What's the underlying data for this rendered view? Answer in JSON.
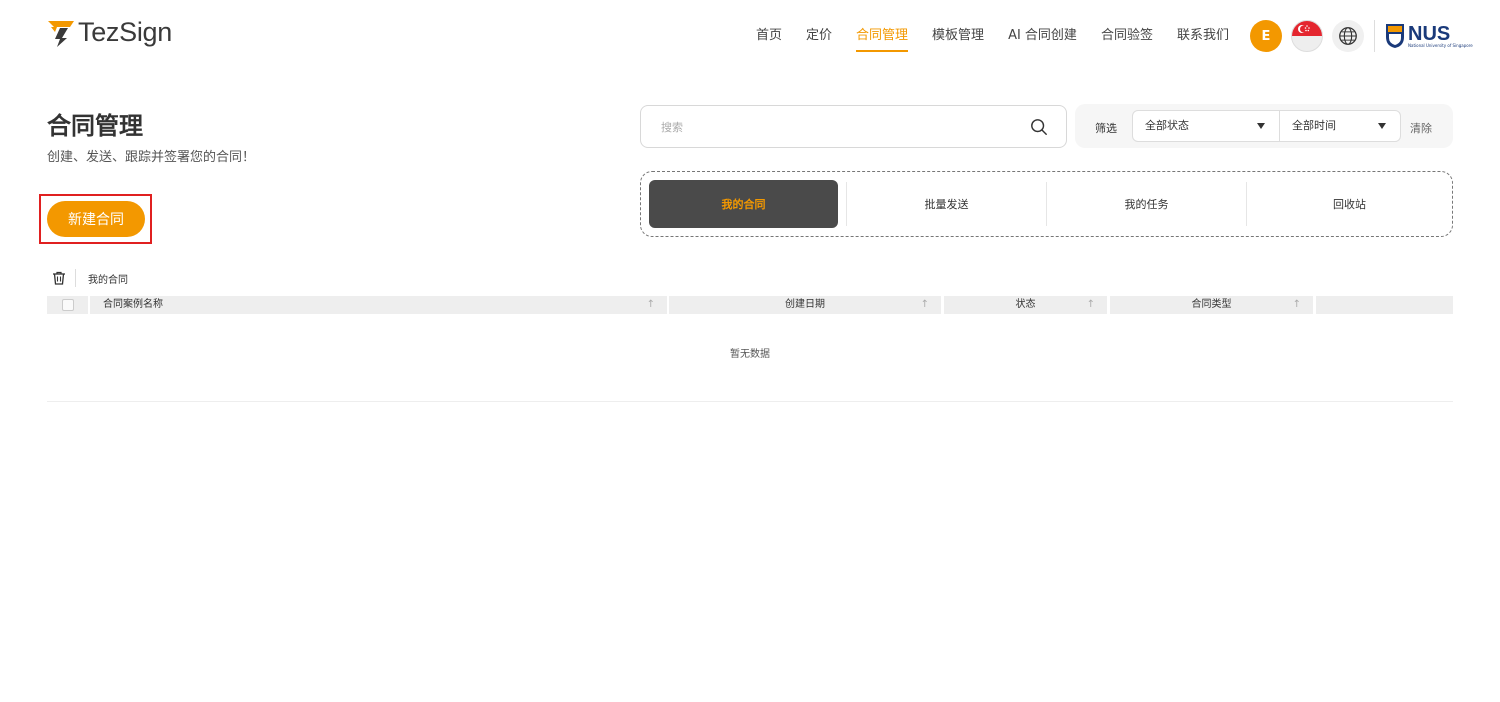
{
  "brand": {
    "name": "TezSign",
    "accent": "#f39800"
  },
  "nav": {
    "items": [
      {
        "label": "首页"
      },
      {
        "label": "定价"
      },
      {
        "label": "合同管理",
        "active": true
      },
      {
        "label": "模板管理"
      },
      {
        "label": "AI 合同创建"
      },
      {
        "label": "合同验签"
      },
      {
        "label": "联系我们"
      }
    ]
  },
  "header": {
    "avatar_initial": "E",
    "flag_icon": "singapore-flag-icon",
    "globe_icon": "globe-icon",
    "partner": {
      "name": "NUS",
      "subtitle": "National University of Singapore"
    }
  },
  "page": {
    "title": "合同管理",
    "subtitle": "创建、发送、跟踪并签署您的合同！",
    "new_button": "新建合同"
  },
  "search": {
    "placeholder": "搜索"
  },
  "filter": {
    "label": "筛选",
    "status": "全部状态",
    "time": "全部时间",
    "clear": "清除"
  },
  "tabs": [
    {
      "label": "我的合同",
      "active": true
    },
    {
      "label": "批量发送"
    },
    {
      "label": "我的任务"
    },
    {
      "label": "回收站"
    }
  ],
  "table": {
    "toolbar_label": "我的合同",
    "columns": [
      {
        "label": "合同案例名称",
        "sortable": true
      },
      {
        "label": "创建日期",
        "sortable": true
      },
      {
        "label": "状态",
        "sortable": true
      },
      {
        "label": "合同类型",
        "sortable": true
      }
    ],
    "empty_text": "暂无数据"
  }
}
